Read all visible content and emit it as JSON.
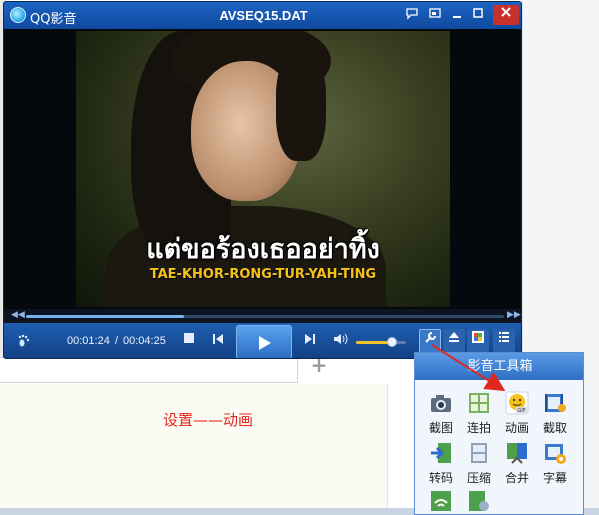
{
  "player": {
    "app_name": "QQ影音",
    "window_title": "AVSEQ15.DAT",
    "lyric_thai": "แต่ขอร้องเธออย่าทิ้ง",
    "lyric_roman": "TAE-KHOR-RONG-TUR-YAH-TING",
    "time_current": "00:01:24",
    "time_separator": "/",
    "time_total": "00:04:25",
    "seek_progress": 0.33,
    "volume_level": 0.72
  },
  "toolbox": {
    "title": "影音工具箱",
    "tools": [
      {
        "label": "截图",
        "icon": "camera-icon"
      },
      {
        "label": "连拍",
        "icon": "burst-icon"
      },
      {
        "label": "动画",
        "icon": "gif-icon"
      },
      {
        "label": "截取",
        "icon": "film-clip-icon"
      },
      {
        "label": "转码",
        "icon": "convert-icon"
      },
      {
        "label": "压缩",
        "icon": "compress-icon"
      },
      {
        "label": "合并",
        "icon": "merge-icon"
      },
      {
        "label": "字幕",
        "icon": "subtitle-gear-icon"
      }
    ]
  },
  "caption": "设置——动画",
  "colors": {
    "title_bar": "#1558b0",
    "controls_bar": "#1a54a3",
    "caption_red": "#e0281e",
    "arrow_red": "#e0281e",
    "lyric_yellow": "#f5c21b"
  }
}
